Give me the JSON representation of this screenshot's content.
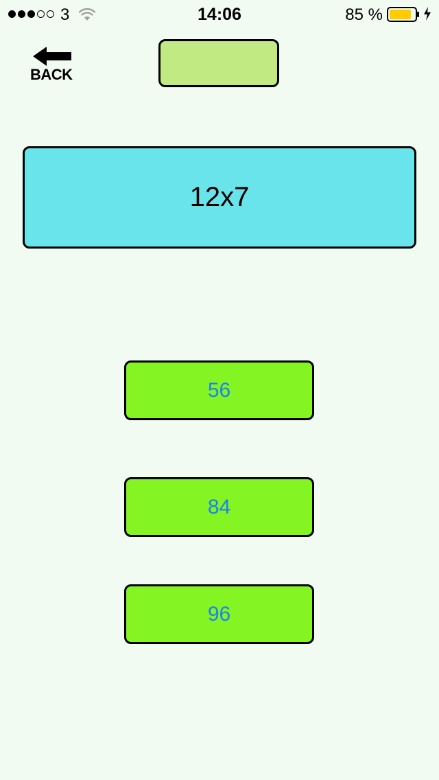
{
  "status_bar": {
    "carrier": "3",
    "time": "14:06",
    "battery_percent": "85 %",
    "signal_bars_filled": 3,
    "signal_bars_total": 5,
    "battery_level": 0.85,
    "battery_color": "#ffcc00"
  },
  "back_button": {
    "label": "BACK",
    "icon": "arrow-left-icon"
  },
  "score_box": {
    "value": "",
    "color": "#c1ea82"
  },
  "question": {
    "text": "12x7",
    "color": "#69e4ea"
  },
  "answers": [
    {
      "label": "56"
    },
    {
      "label": "84"
    },
    {
      "label": "96"
    }
  ],
  "colors": {
    "background": "#f2fbf2",
    "answer_button": "#84f423",
    "answer_text": "#1a82f0"
  }
}
